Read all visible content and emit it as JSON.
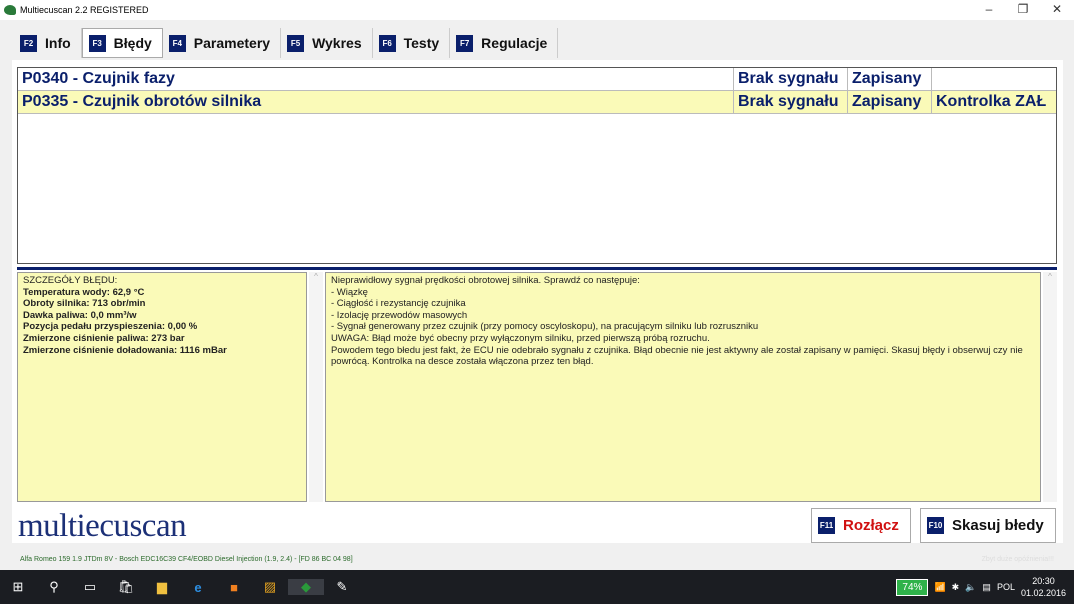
{
  "window": {
    "title": "Multiecuscan 2.2 REGISTERED"
  },
  "tabs": [
    {
      "key": "F2",
      "label": "Info"
    },
    {
      "key": "F3",
      "label": "Błędy"
    },
    {
      "key": "F4",
      "label": "Parametery"
    },
    {
      "key": "F5",
      "label": "Wykres"
    },
    {
      "key": "F6",
      "label": "Testy"
    },
    {
      "key": "F7",
      "label": "Regulacje"
    }
  ],
  "errors": [
    {
      "code": "P0340 - Czujnik fazy",
      "type": "Brak sygnału",
      "state": "Zapisany",
      "lamp": ""
    },
    {
      "code": "P0335 - Czujnik obrotów silnika",
      "type": "Brak sygnału",
      "state": "Zapisany",
      "lamp": "Kontrolka ZAŁ"
    }
  ],
  "details": {
    "lines": [
      "SZCZEGÓŁY BŁĘDU:",
      "Temperatura wody: 62,9 °C",
      "Obroty silnika: 713 obr/min",
      "Dawka paliwa: 0,0 mm³/w",
      "Pozycja pedału przyspieszenia: 0,00 %",
      "Zmierzone ciśnienie paliwa: 273 bar",
      "Zmierzone ciśnienie doładowania: 1116 mBar"
    ]
  },
  "description": {
    "lines": [
      "Nieprawidłowy sygnał prędkości obrotowej silnika. Sprawdź co następuje:",
      "- Wiązkę",
      "- Ciągłość i rezystancję czujnika",
      "- Izolację przewodów masowych",
      "- Sygnał generowany przez czujnik (przy pomocy oscyloskopu), na pracującym silniku lub rozruszniku",
      "UWAGA: Błąd może być obecny przy wyłączonym silniku, przed pierwszą próbą rozruchu.",
      "Powodem tego błedu jest fakt, że ECU nie odebrało sygnału z czujnika. Błąd obecnie nie jest aktywny ale został zapisany w pamięci. Skasuj błędy i obserwuj czy nie powrócą. Kontrolka na desce została włączona przez ten błąd."
    ]
  },
  "logo": "multiecuscan",
  "buttons": {
    "disconnect": {
      "key": "F11",
      "label": "Rozłącz"
    },
    "clear": {
      "key": "F10",
      "label": "Skasuj błedy"
    }
  },
  "status": {
    "vehicle": "Alfa Romeo 159 1.9 JTDm 8V - Bosch EDC16C39 CF4/EOBD Diesel Injection (1.9, 2.4) - [FD 86 BC 04 98]",
    "warning": "Zbyt duże opóźnienia!!!"
  },
  "taskbar": {
    "battery": "74%",
    "lang": "POL",
    "time": "20:30",
    "date": "01.02.2016"
  },
  "colors": {
    "accent": "#0a1f6b",
    "highlight": "#fafab8",
    "disconnect": "#d01010"
  }
}
